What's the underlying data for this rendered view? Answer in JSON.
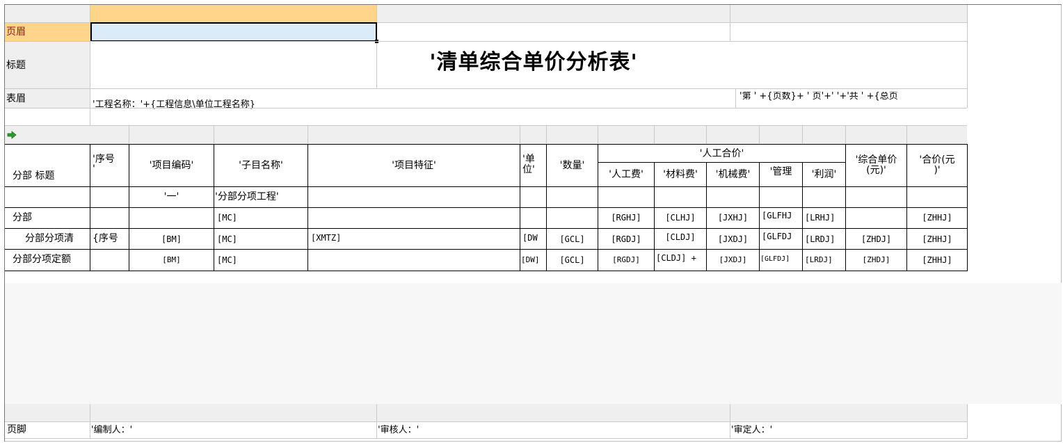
{
  "row_labels": {
    "header": "页眉",
    "title": "标题",
    "table_header": "表眉",
    "detail_dept": "分部 标题",
    "dept": "分部",
    "item": "分部分项清",
    "quota": "分部分项定额",
    "footer": "页脚"
  },
  "title": "'清单综合单价分析表'",
  "table_header": {
    "project_name": "'工程名称：'+{工程信息\\单位工程名称}",
    "page_info": "'第 ' +{页数}+ ' 页'+'  '+'共 ' +{总页"
  },
  "detail_marker_icon": "green-arrow-right-icon",
  "columns": {
    "seq": "'序号\n'",
    "code": "'项目编码'",
    "name": "'子目名称'",
    "feature": "'项目特征'",
    "unit": "'单\n位'",
    "qty": "'数量'",
    "labor_group": "'人工合价'",
    "labor": "'人工费'",
    "material": "'材料费'",
    "machine": "'机械费'",
    "manage": "'管理",
    "profit": "'利润'",
    "unit_price": "'综合单价\n(元)'",
    "total": "'合价(元\n)'"
  },
  "sub_row": {
    "code": "'一'",
    "name": "'分部分项工程'"
  },
  "dept_row": {
    "name": "[MC]",
    "labor": "[RGHJ]",
    "material": "[CLHJ]",
    "machine": "[JXHJ]",
    "manage": "[GLFHJ",
    "profit": "[LRHJ]",
    "total": "[ZHHJ]"
  },
  "item_row": {
    "seq": "{序号",
    "code": "[BM]",
    "name": "[MC]",
    "feature": "[XMTZ]",
    "unit": "[DW",
    "qty": "[GCL]",
    "labor": "[RGDJ]",
    "material": "[CLDJ]",
    "machine": "[JXDJ]",
    "manage": "[GLFDJ",
    "profit": "[LRDJ]",
    "unit_price": "[ZHDJ]",
    "total": "[ZHHJ]"
  },
  "quota_row": {
    "code": "[BM]",
    "name": "[MC]",
    "unit": "[DW]",
    "qty": "[GCL]",
    "labor": "[RGDJ]",
    "material": "[CLDJ] +",
    "machine": "[JXDJ]",
    "manage": "[GLFDJ]",
    "profit": "[LRDJ]",
    "unit_price": "[ZHDJ]",
    "total": "[ZHHJ]"
  },
  "footer": {
    "preparer": "'编制人：'",
    "reviewer": "'审核人：'",
    "approver": "'审定人：'"
  }
}
